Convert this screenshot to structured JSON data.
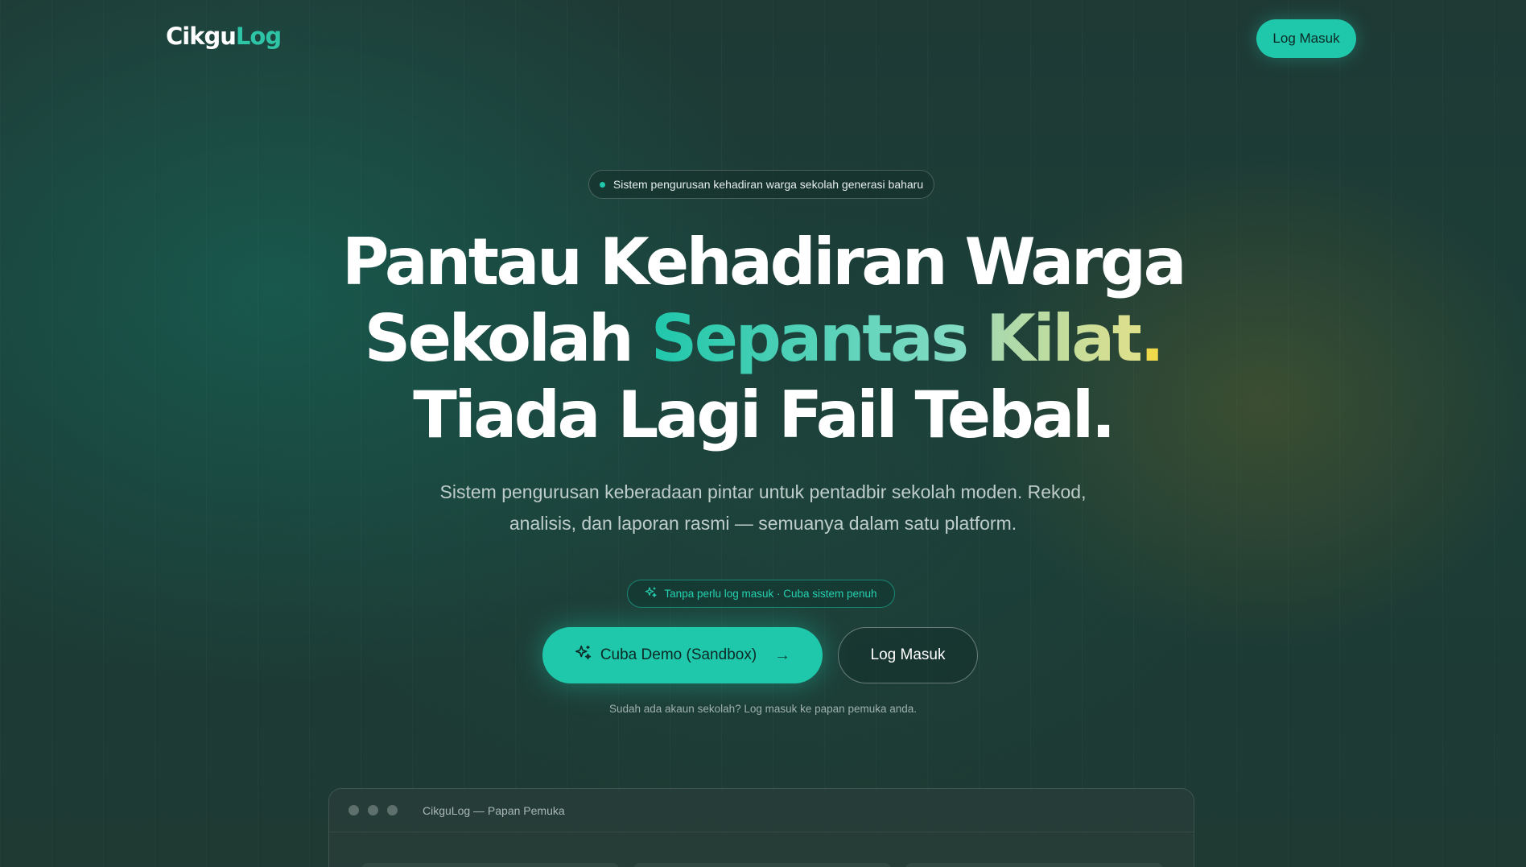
{
  "nav": {
    "logo_part1": "Cikgu",
    "logo_part2": "Log",
    "login_label": "Log Masuk"
  },
  "badge": {
    "text": "Sistem pengurusan kehadiran warga sekolah generasi baharu"
  },
  "hero": {
    "line1": "Pantau Kehadiran Warga",
    "line2_plain": "Sekolah ",
    "line2_highlight1": "Sepantas",
    "line2_space": " ",
    "line2_highlight2": "Kilat",
    "line2_dot": ".",
    "line3": "Tiada Lagi Fail Tebal."
  },
  "subtitle": "Sistem pengurusan keberadaan pintar untuk pentadbir sekolah moden. Rekod, analisis, dan laporan rasmi — semuanya dalam satu platform.",
  "pill": {
    "icon": "sparkles-icon",
    "text": "Tanpa perlu log masuk · Cuba sistem penuh"
  },
  "cta": {
    "demo_label": "Cuba Demo (Sandbox)",
    "demo_icon": "sparkles-icon",
    "demo_arrow": "→",
    "login_label": "Log Masuk"
  },
  "hint": "Sudah ada akaun sekolah? Log masuk ke papan pemuka anda.",
  "preview": {
    "title": "CikguLog — Papan Pemuka"
  },
  "colors": {
    "accent": "#1fc7ab",
    "background": "#1e3a35",
    "highlight_yellow": "#f1d94c"
  }
}
